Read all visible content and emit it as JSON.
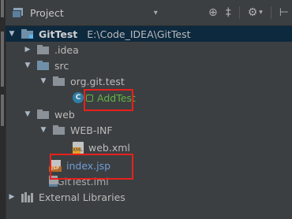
{
  "panel": {
    "title": "Project",
    "caret": "▾",
    "tools": {
      "sync": "⊕",
      "collapse": "‡",
      "settings": "⚙",
      "settings_caret": "▾",
      "hide": "⊢"
    }
  },
  "tree": {
    "root": {
      "name": "GitTest",
      "path": "E:\\Code_IDEA\\GitTest"
    },
    "idea": ".idea",
    "src": "src",
    "package": "org.git.test",
    "class_icon": "C",
    "class": "AddTest",
    "web": "web",
    "webinf": "WEB-INF",
    "webxml": "web.xml",
    "xml_badge": "XML",
    "indexjsp": "index.jsp",
    "jsp_badge": "JSP",
    "iml": "GitTest.iml",
    "libraries": "External Libraries"
  },
  "colors": {
    "background": "#3c3f41",
    "selection": "#0d293e",
    "highlight_box": "#e8201c",
    "added_file": "#62b543",
    "modified_file": "#6f9ed9"
  }
}
